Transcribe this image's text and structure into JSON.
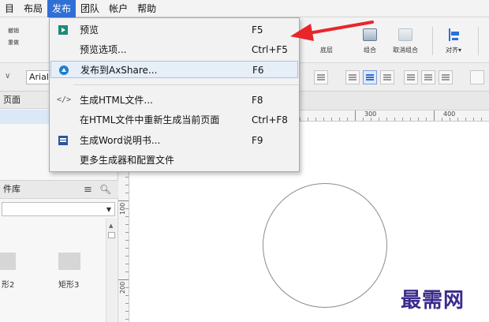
{
  "menubar": {
    "items": [
      {
        "label": "目"
      },
      {
        "label": "布局"
      },
      {
        "label": "发布"
      },
      {
        "label": "团队"
      },
      {
        "label": "帐户"
      },
      {
        "label": "帮助"
      }
    ]
  },
  "toolbar": {
    "undo_label": "撤销",
    "redo_label": "重做",
    "bottom_label": "底层",
    "group_label": "组合",
    "ungroup_label": "取消组合",
    "align_label": "对齐▾"
  },
  "format": {
    "font_value": "Arial"
  },
  "left_panel": {
    "pages_title": "页面",
    "library_title": "件库",
    "widgets": [
      {
        "label": "形2"
      },
      {
        "label": "矩形3"
      }
    ]
  },
  "rulers": {
    "top_labels": [
      "300",
      "400"
    ],
    "left_labels": [
      "100",
      "200"
    ]
  },
  "publish_menu": {
    "items": [
      {
        "label": "预览",
        "shortcut": "F5",
        "icon": "preview-play-icon"
      },
      {
        "label": "预览选项...",
        "shortcut": "Ctrl+F5",
        "icon": ""
      },
      {
        "label": "发布到AxShare...",
        "shortcut": "F6",
        "icon": "cloud-upload-icon"
      },
      {
        "label": "生成HTML文件...",
        "shortcut": "F8",
        "icon": "code-icon"
      },
      {
        "label": "在HTML文件中重新生成当前页面",
        "shortcut": "Ctrl+F8",
        "icon": ""
      },
      {
        "label": "生成Word说明书...",
        "shortcut": "F9",
        "icon": "word-doc-icon"
      },
      {
        "label": "更多生成器和配置文件",
        "shortcut": "",
        "icon": ""
      }
    ]
  },
  "watermark": {
    "text": "最需网"
  },
  "colors": {
    "menu_active": "#2f6fd6",
    "arrow": "#e8262a",
    "watermark": "#3b2a8c"
  }
}
